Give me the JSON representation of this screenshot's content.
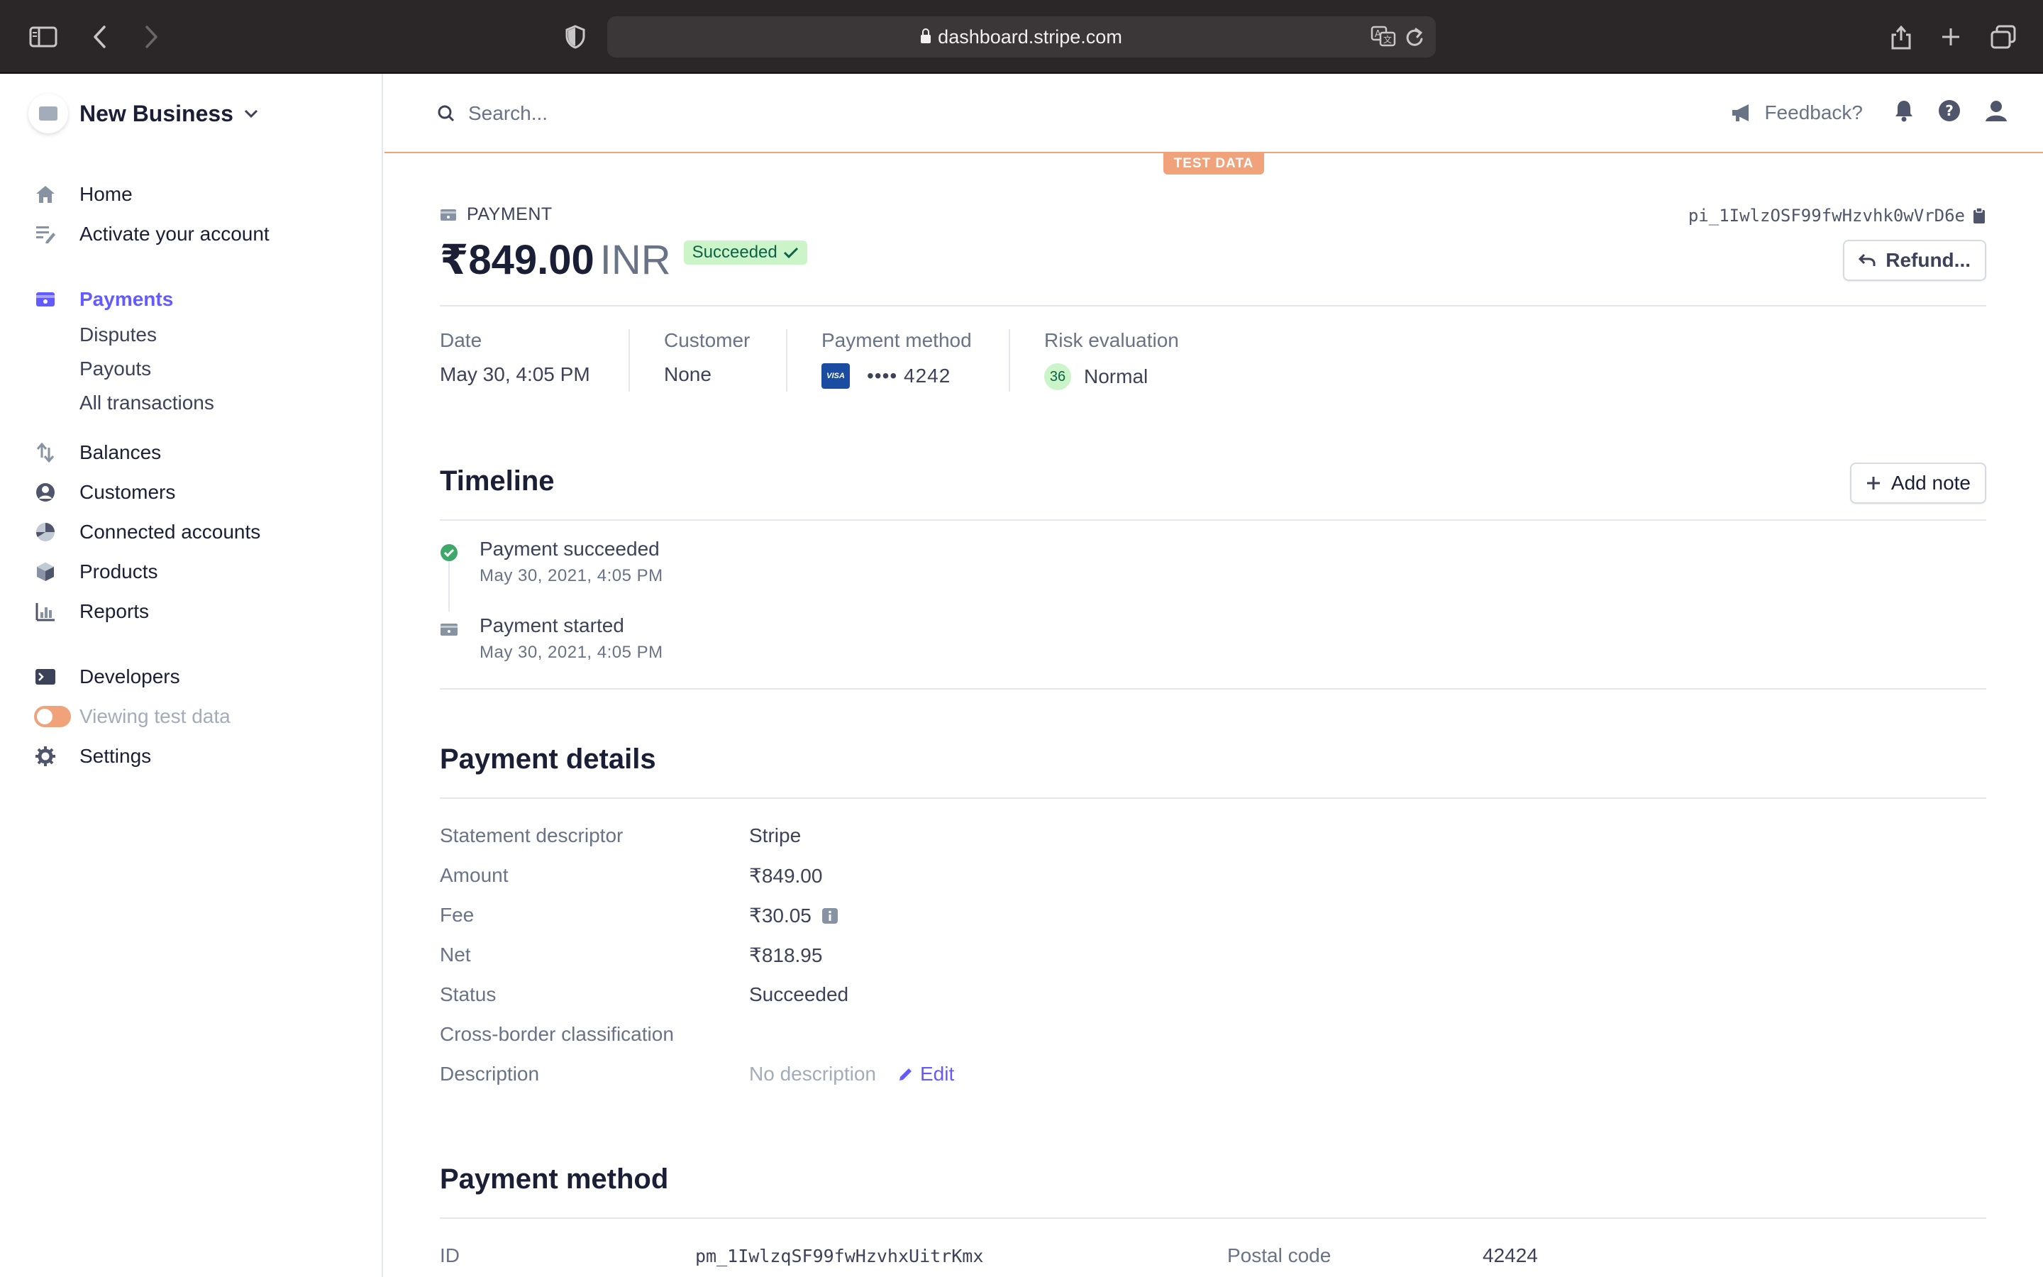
{
  "browser": {
    "url": "dashboard.stripe.com"
  },
  "sidebar": {
    "business_name": "New Business",
    "items": [
      {
        "label": "Home"
      },
      {
        "label": "Activate your account"
      },
      {
        "label": "Payments"
      },
      {
        "label": "Disputes"
      },
      {
        "label": "Payouts"
      },
      {
        "label": "All transactions"
      },
      {
        "label": "Balances"
      },
      {
        "label": "Customers"
      },
      {
        "label": "Connected accounts"
      },
      {
        "label": "Products"
      },
      {
        "label": "Reports"
      },
      {
        "label": "Developers"
      },
      {
        "label": "Viewing test data"
      },
      {
        "label": "Settings"
      }
    ]
  },
  "topbar": {
    "search_placeholder": "Search...",
    "feedback_label": "Feedback?",
    "test_badge": "TEST DATA"
  },
  "payment": {
    "type_label": "PAYMENT",
    "id": "pi_1IwlzOSF99fwHzvhk0wVrD6e",
    "amount": "₹849.00",
    "currency": "INR",
    "status_badge": "Succeeded",
    "refund_label": "Refund...",
    "summary": {
      "date_label": "Date",
      "date_value": "May 30, 4:05 PM",
      "customer_label": "Customer",
      "customer_value": "None",
      "method_label": "Payment method",
      "method_brand": "VISA",
      "method_value": "•••• 4242",
      "risk_label": "Risk evaluation",
      "risk_score": "36",
      "risk_value": "Normal"
    }
  },
  "timeline": {
    "title": "Timeline",
    "add_note_label": "Add note",
    "events": [
      {
        "title": "Payment succeeded",
        "date": "May 30, 2021, 4:05 PM"
      },
      {
        "title": "Payment started",
        "date": "May 30, 2021, 4:05 PM"
      }
    ]
  },
  "details": {
    "title": "Payment details",
    "rows": [
      {
        "key": "Statement descriptor",
        "value": "Stripe"
      },
      {
        "key": "Amount",
        "value": "₹849.00"
      },
      {
        "key": "Fee",
        "value": "₹30.05"
      },
      {
        "key": "Net",
        "value": "₹818.95"
      },
      {
        "key": "Status",
        "value": "Succeeded"
      },
      {
        "key": "Cross-border classification",
        "value": ""
      },
      {
        "key": "Description",
        "value": "No description"
      }
    ],
    "edit_label": "Edit"
  },
  "payment_method": {
    "title": "Payment method",
    "id_label": "ID",
    "id_value": "pm_1IwlzqSF99fwHzvhxUitrKmx",
    "postal_label": "Postal code",
    "postal_value": "42424"
  },
  "colors": {
    "accent": "#635bff",
    "test_orange": "#f0a27b",
    "success_bg": "#cbf4c9",
    "success_text": "#0e6245",
    "chrome_bg": "#2b2628"
  }
}
